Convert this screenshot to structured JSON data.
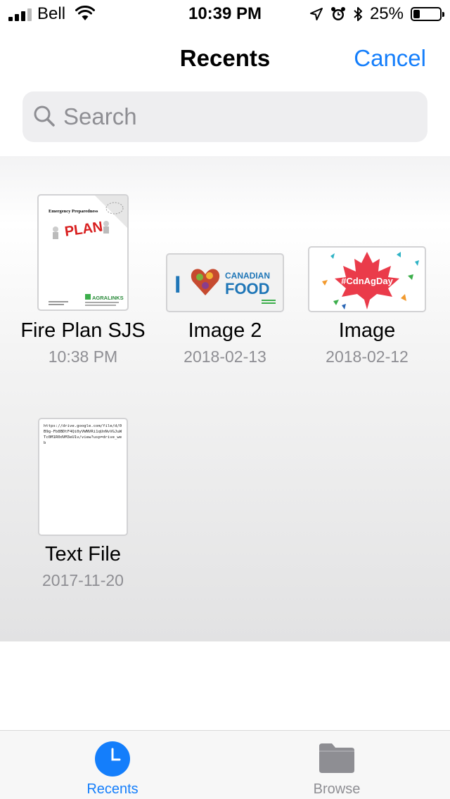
{
  "status_bar": {
    "carrier": "Bell",
    "time": "10:39 PM",
    "battery_percent": "25%",
    "battery_level": 0.25,
    "signal_bars": 3,
    "icons": [
      "wifi-icon",
      "location-arrow-icon",
      "alarm-clock-icon",
      "bluetooth-icon",
      "battery-icon"
    ]
  },
  "nav": {
    "title": "Recents",
    "cancel_label": "Cancel"
  },
  "search": {
    "placeholder": "Search"
  },
  "files": [
    {
      "name": "Fire Plan SJS",
      "date": "10:38 PM",
      "thumb": {
        "heading": "Emergency Preparedness",
        "graphic_text": "PLAN",
        "logo_text": "AGRALINKS"
      }
    },
    {
      "name": "Image 2",
      "date": "2018-02-13",
      "thumb": {
        "letter": "I",
        "line1": "CANADIAN",
        "line2": "FOOD"
      }
    },
    {
      "name": "Image",
      "date": "2018-02-12",
      "thumb": {
        "hashtag": "#CdnAgDay"
      }
    },
    {
      "name": "Text File",
      "date": "2017-11-20",
      "thumb": {
        "text": "https://drive.google.com/file/d/0B9g-Fb8BDtF4Qi0yVWNVRi1qUnNvVGJuWTc0M1R0dVM3eU1v/view?usp=drive_web"
      }
    }
  ],
  "tabs": [
    {
      "label": "Recents",
      "active": true
    },
    {
      "label": "Browse",
      "active": false
    }
  ],
  "colors": {
    "accent": "#147efb",
    "inactive": "#8e8e93",
    "maple": "#ea3b4a"
  }
}
